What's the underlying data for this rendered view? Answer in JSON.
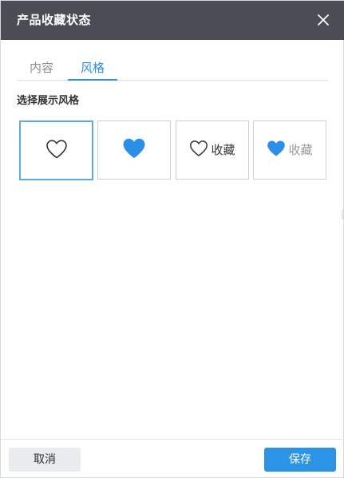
{
  "dialog": {
    "title": "产品收藏状态",
    "close_icon": "close-icon"
  },
  "tabs": [
    {
      "label": "内容",
      "active": false
    },
    {
      "label": "风格",
      "active": true
    }
  ],
  "section": {
    "label": "选择展示风格"
  },
  "style_options": [
    {
      "icon": "heart-outline-icon",
      "label": "",
      "selected": true
    },
    {
      "icon": "heart-filled-icon",
      "label": "",
      "selected": false
    },
    {
      "icon": "heart-outline-icon",
      "label": "收藏",
      "selected": false
    },
    {
      "icon": "heart-filled-icon",
      "label": "收藏",
      "selected": false
    }
  ],
  "footer": {
    "cancel_label": "取消",
    "save_label": "保存"
  },
  "colors": {
    "titlebar_bg": "#4a4d54",
    "accent": "#2b8fe8",
    "selected_border": "#5aa9e6",
    "heart_filled": "#2b8fe8",
    "cancel_bg": "#e9ebef",
    "save_bg": "#2b94e6"
  }
}
